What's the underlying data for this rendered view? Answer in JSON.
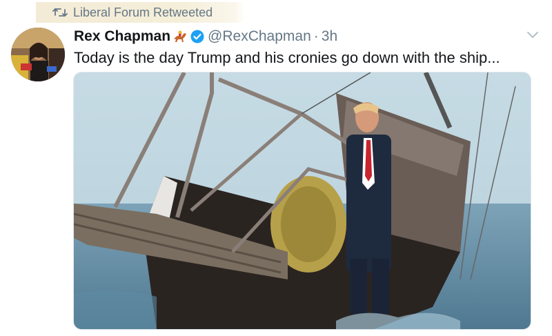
{
  "retweet": {
    "label": "Liberal Forum Retweeted",
    "icon": "retweet-icon"
  },
  "tweet": {
    "display_name": "Rex Chapman",
    "name_emoji": "horse-racing-emoji",
    "verified": true,
    "handle": "@RexChapman",
    "separator": "·",
    "timestamp": "3h",
    "text": "Today is the day Trump and his cronies go down with the ship...",
    "menu_icon": "chevron-down-icon",
    "media": {
      "type": "image",
      "description_icon": "sinking-boat-image"
    }
  },
  "colors": {
    "secondary_text": "#657786",
    "primary_text": "#14171a",
    "verified_blue": "#1da1f2",
    "banner_highlight": "#f3ebd6"
  }
}
